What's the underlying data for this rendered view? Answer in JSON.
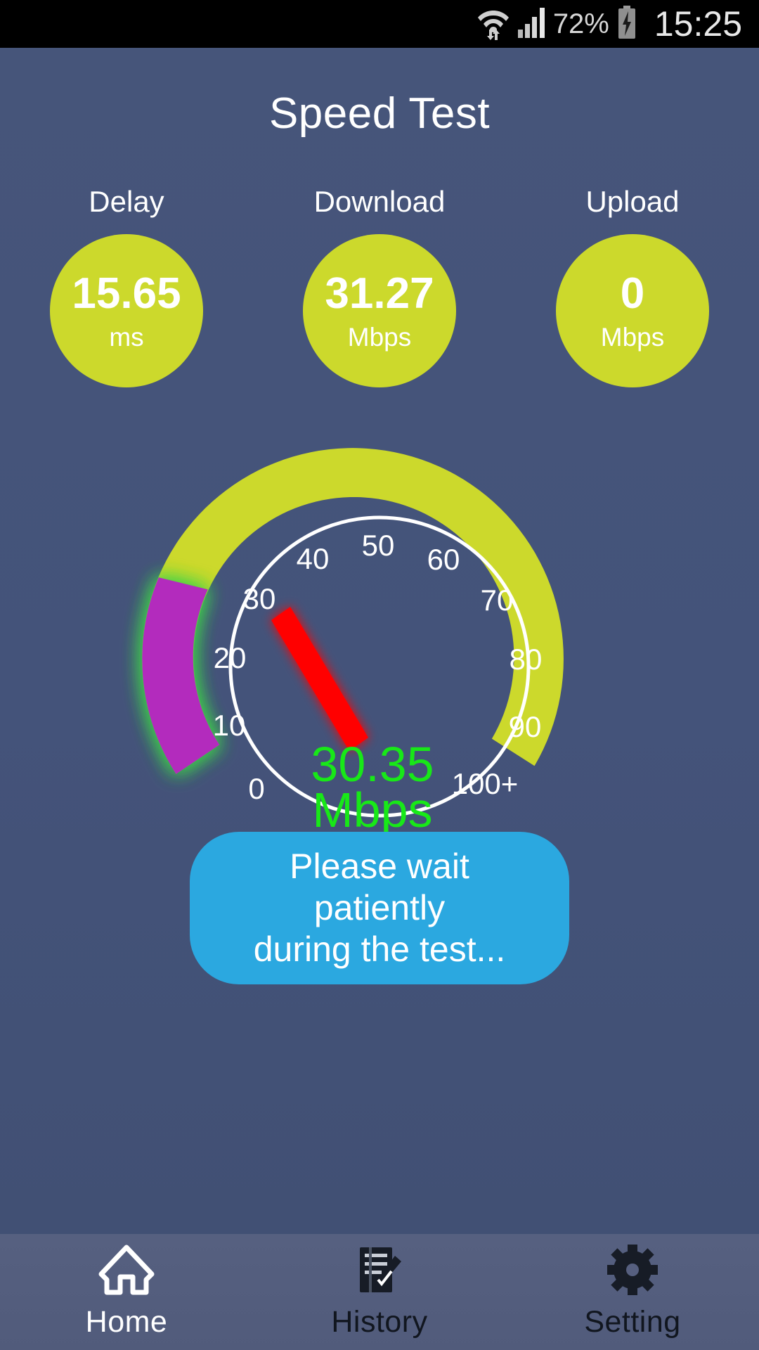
{
  "statusbar": {
    "wifi_icon": "wifi-transfer-icon",
    "signal_icon": "signal-bars-icon",
    "battery_percent": "72%",
    "battery_icon": "battery-charging-icon",
    "clock": "15:25"
  },
  "header": {
    "title": "Speed Test"
  },
  "stats": [
    {
      "label": "Delay",
      "value": "15.65",
      "unit": "ms",
      "name": "delay"
    },
    {
      "label": "Download",
      "value": "31.27",
      "unit": "Mbps",
      "name": "download"
    },
    {
      "label": "Upload",
      "value": "0",
      "unit": "Mbps",
      "name": "upload"
    }
  ],
  "gauge": {
    "readout_value": "30.35",
    "readout_unit": "Mbps",
    "needle_value": 26.5,
    "progress_value": 25,
    "min": 0,
    "max": 100,
    "tick_labels": [
      "0",
      "10",
      "20",
      "30",
      "40",
      "50",
      "60",
      "70",
      "80",
      "90",
      "100+"
    ],
    "colors": {
      "track": "#ccd92c",
      "progress": "#b32bbd",
      "glow": "#3dd14a",
      "needle": "#ff0000",
      "dial_outline": "#ffffff",
      "readout": "#18e818"
    }
  },
  "status_message": {
    "text": "Please wait patiently\nduring the test..."
  },
  "bottom_nav": [
    {
      "label": "Home",
      "icon": "home-icon",
      "active": true
    },
    {
      "label": "History",
      "icon": "history-icon",
      "active": false
    },
    {
      "label": "Setting",
      "icon": "gear-icon",
      "active": false
    }
  ]
}
